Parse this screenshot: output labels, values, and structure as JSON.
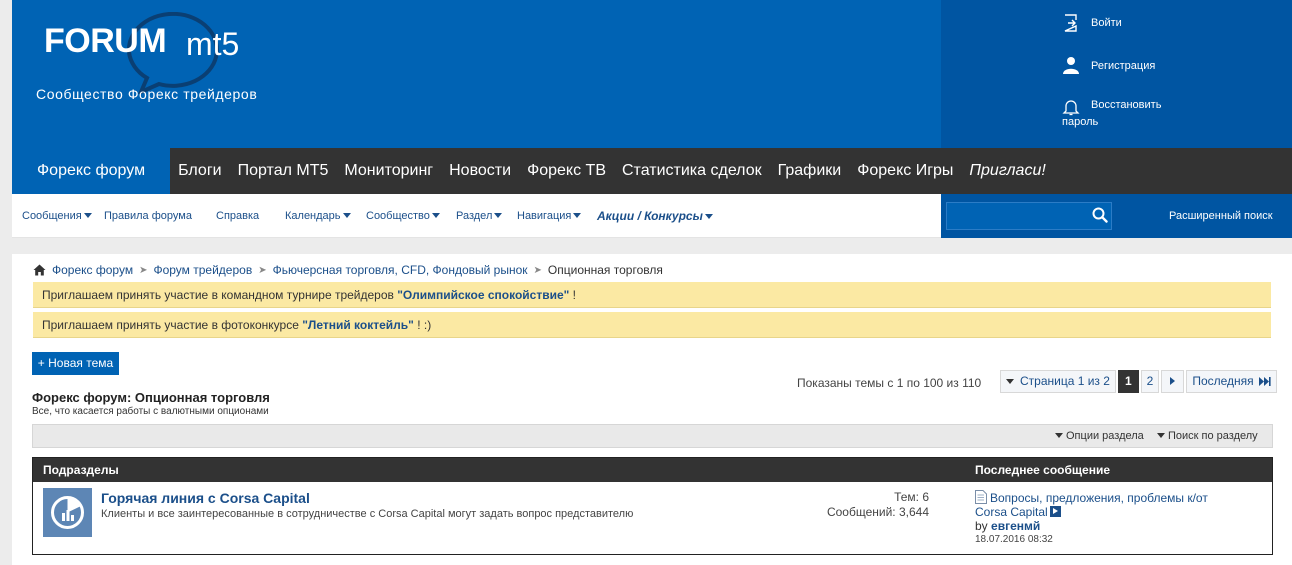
{
  "header": {
    "logo_forum": "FORUM",
    "logo_mt5": "mt5",
    "tagline": "Сообщество Форекс трейдеров",
    "account": {
      "login": "Войти",
      "register": "Регистрация",
      "recover_line1": "Восстановить",
      "recover_line2": "пароль"
    }
  },
  "main_nav": [
    {
      "label": "Форекс форум",
      "active": true
    },
    {
      "label": "Блоги"
    },
    {
      "label": "Портал MT5"
    },
    {
      "label": "Мониторинг"
    },
    {
      "label": "Новости"
    },
    {
      "label": "Форекс ТВ"
    },
    {
      "label": "Статистика сделок"
    },
    {
      "label": "Графики"
    },
    {
      "label": "Форекс Игры"
    },
    {
      "label": "Пригласи!"
    }
  ],
  "sub_nav": {
    "messages": "Сообщения",
    "rules": "Правила форума",
    "help": "Справка",
    "calendar": "Календарь",
    "community": "Сообщество",
    "section": "Раздел",
    "navigation": "Навигация",
    "promos": "Акции / Конкурсы"
  },
  "search": {
    "value": "",
    "advanced": "Расширенный поиск"
  },
  "breadcrumb": {
    "items": [
      "Форекс форум",
      "Форум трейдеров",
      "Фьючерсная торговля, CFD, Фондовый рынок"
    ],
    "current": "Опционная торговля"
  },
  "notices": [
    {
      "text": "Приглашаем принять участие в командном турнире трейдеров ",
      "link": "\"Олимпийское спокойствие\"",
      "tail": " !"
    },
    {
      "text": "Приглашаем принять участие в фотоконкурсе ",
      "link": "\"Летний коктейль\"",
      "tail": " ! :)"
    }
  ],
  "new_topic_label": "+ Новая тема",
  "forum": {
    "title": "Форекс форум: Опционная торговля",
    "description": "Все, что касается работы с валютными опционами"
  },
  "threads_shown": "Показаны темы с 1 по 100 из 110",
  "pager": {
    "page_of": "Страница 1 из 2",
    "current": "1",
    "next_page": "2",
    "last": "Последняя"
  },
  "toolbar": {
    "section_options": "Опции раздела",
    "search_section": "Поиск по разделу"
  },
  "table": {
    "col_subforums": "Подразделы",
    "col_last_post": "Последнее сообщение",
    "rows": [
      {
        "title": "Горячая линия с Corsa Capital",
        "description": "Клиенты и все заинтересованные в сотрудничестве с Corsa Capital могут задать вопрос представителю",
        "topics": "Тем: 6",
        "posts": "Сообщений: 3,644",
        "last_title_1": "Вопросы, предложения, проблемы к/от",
        "last_title_2": "Corsa Capital",
        "last_by": "by ",
        "last_user": "евгенмй",
        "last_date": "18.07.2016 08:32"
      }
    ]
  },
  "colors": {
    "brand_blue": "#0063b4",
    "brand_dark_blue": "#0055a2",
    "nav_dark": "#333333",
    "notice_yellow": "#fbe9a3",
    "link": "#1b4f8a"
  }
}
